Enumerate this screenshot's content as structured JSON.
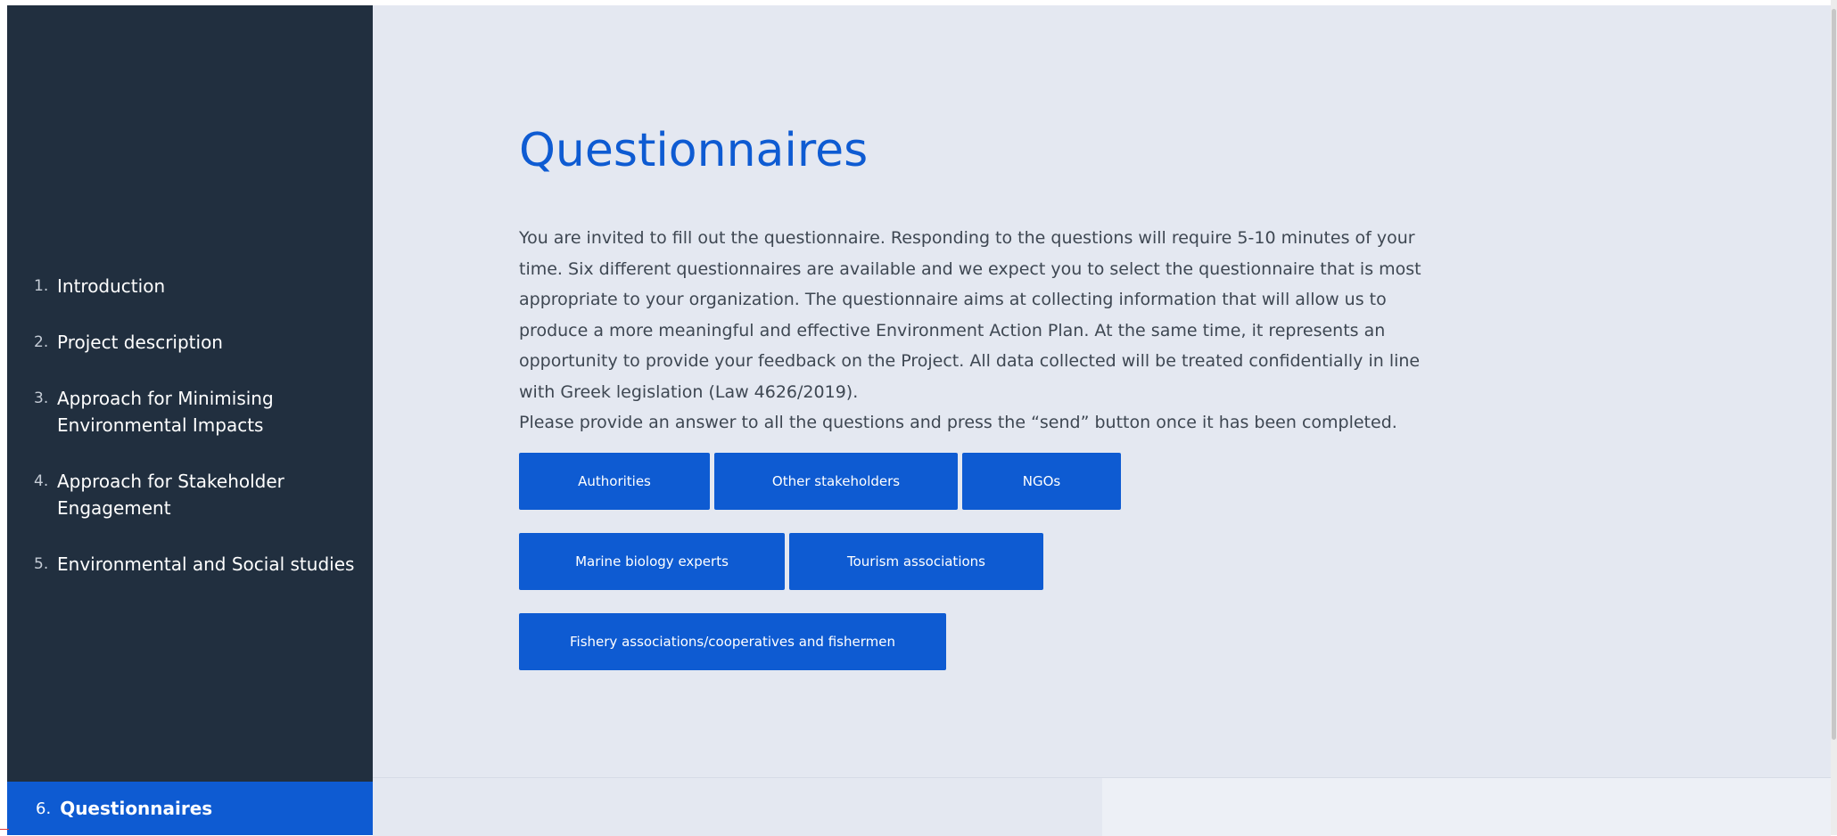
{
  "sidebar": {
    "items": [
      {
        "num": "1.",
        "label": "Introduction"
      },
      {
        "num": "2.",
        "label": "Project description"
      },
      {
        "num": "3.",
        "label": "Approach for Minimising Environmental Impacts"
      },
      {
        "num": "4.",
        "label": "Approach for Stakeholder Engagement"
      },
      {
        "num": "5.",
        "label": "Environmental and Social studies"
      }
    ],
    "active": {
      "num": "6.",
      "label": "Questionnaires"
    }
  },
  "main": {
    "title": "Questionnaires",
    "intro": "You are invited to fill out the questionnaire. Responding to the questions will require 5-10 minutes of your time. Six different questionnaires are available and we expect you to select the questionnaire that is most appropriate to your organization. The questionnaire aims at collecting information that will allow us to produce a more meaningful and effective Environment Action Plan. At the same time, it represents an opportunity to provide your feedback on the Project. All data collected will be treated confidentially in line with Greek legislation (Law 4626/2019).",
    "instruction": "Please provide an answer to all the questions and press the “send” button once it has been completed.",
    "buttons": {
      "authorities": "Authorities",
      "other_stakeholders": "Other stakeholders",
      "ngos": "NGOs",
      "marine_biology": "Marine biology experts",
      "tourism": "Tourism associations",
      "fishery": "Fishery associations/cooperatives and fishermen"
    }
  },
  "colors": {
    "accent": "#0e5bd2",
    "sidebar_bg": "#212f3f",
    "main_bg": "#e4e8f1"
  }
}
